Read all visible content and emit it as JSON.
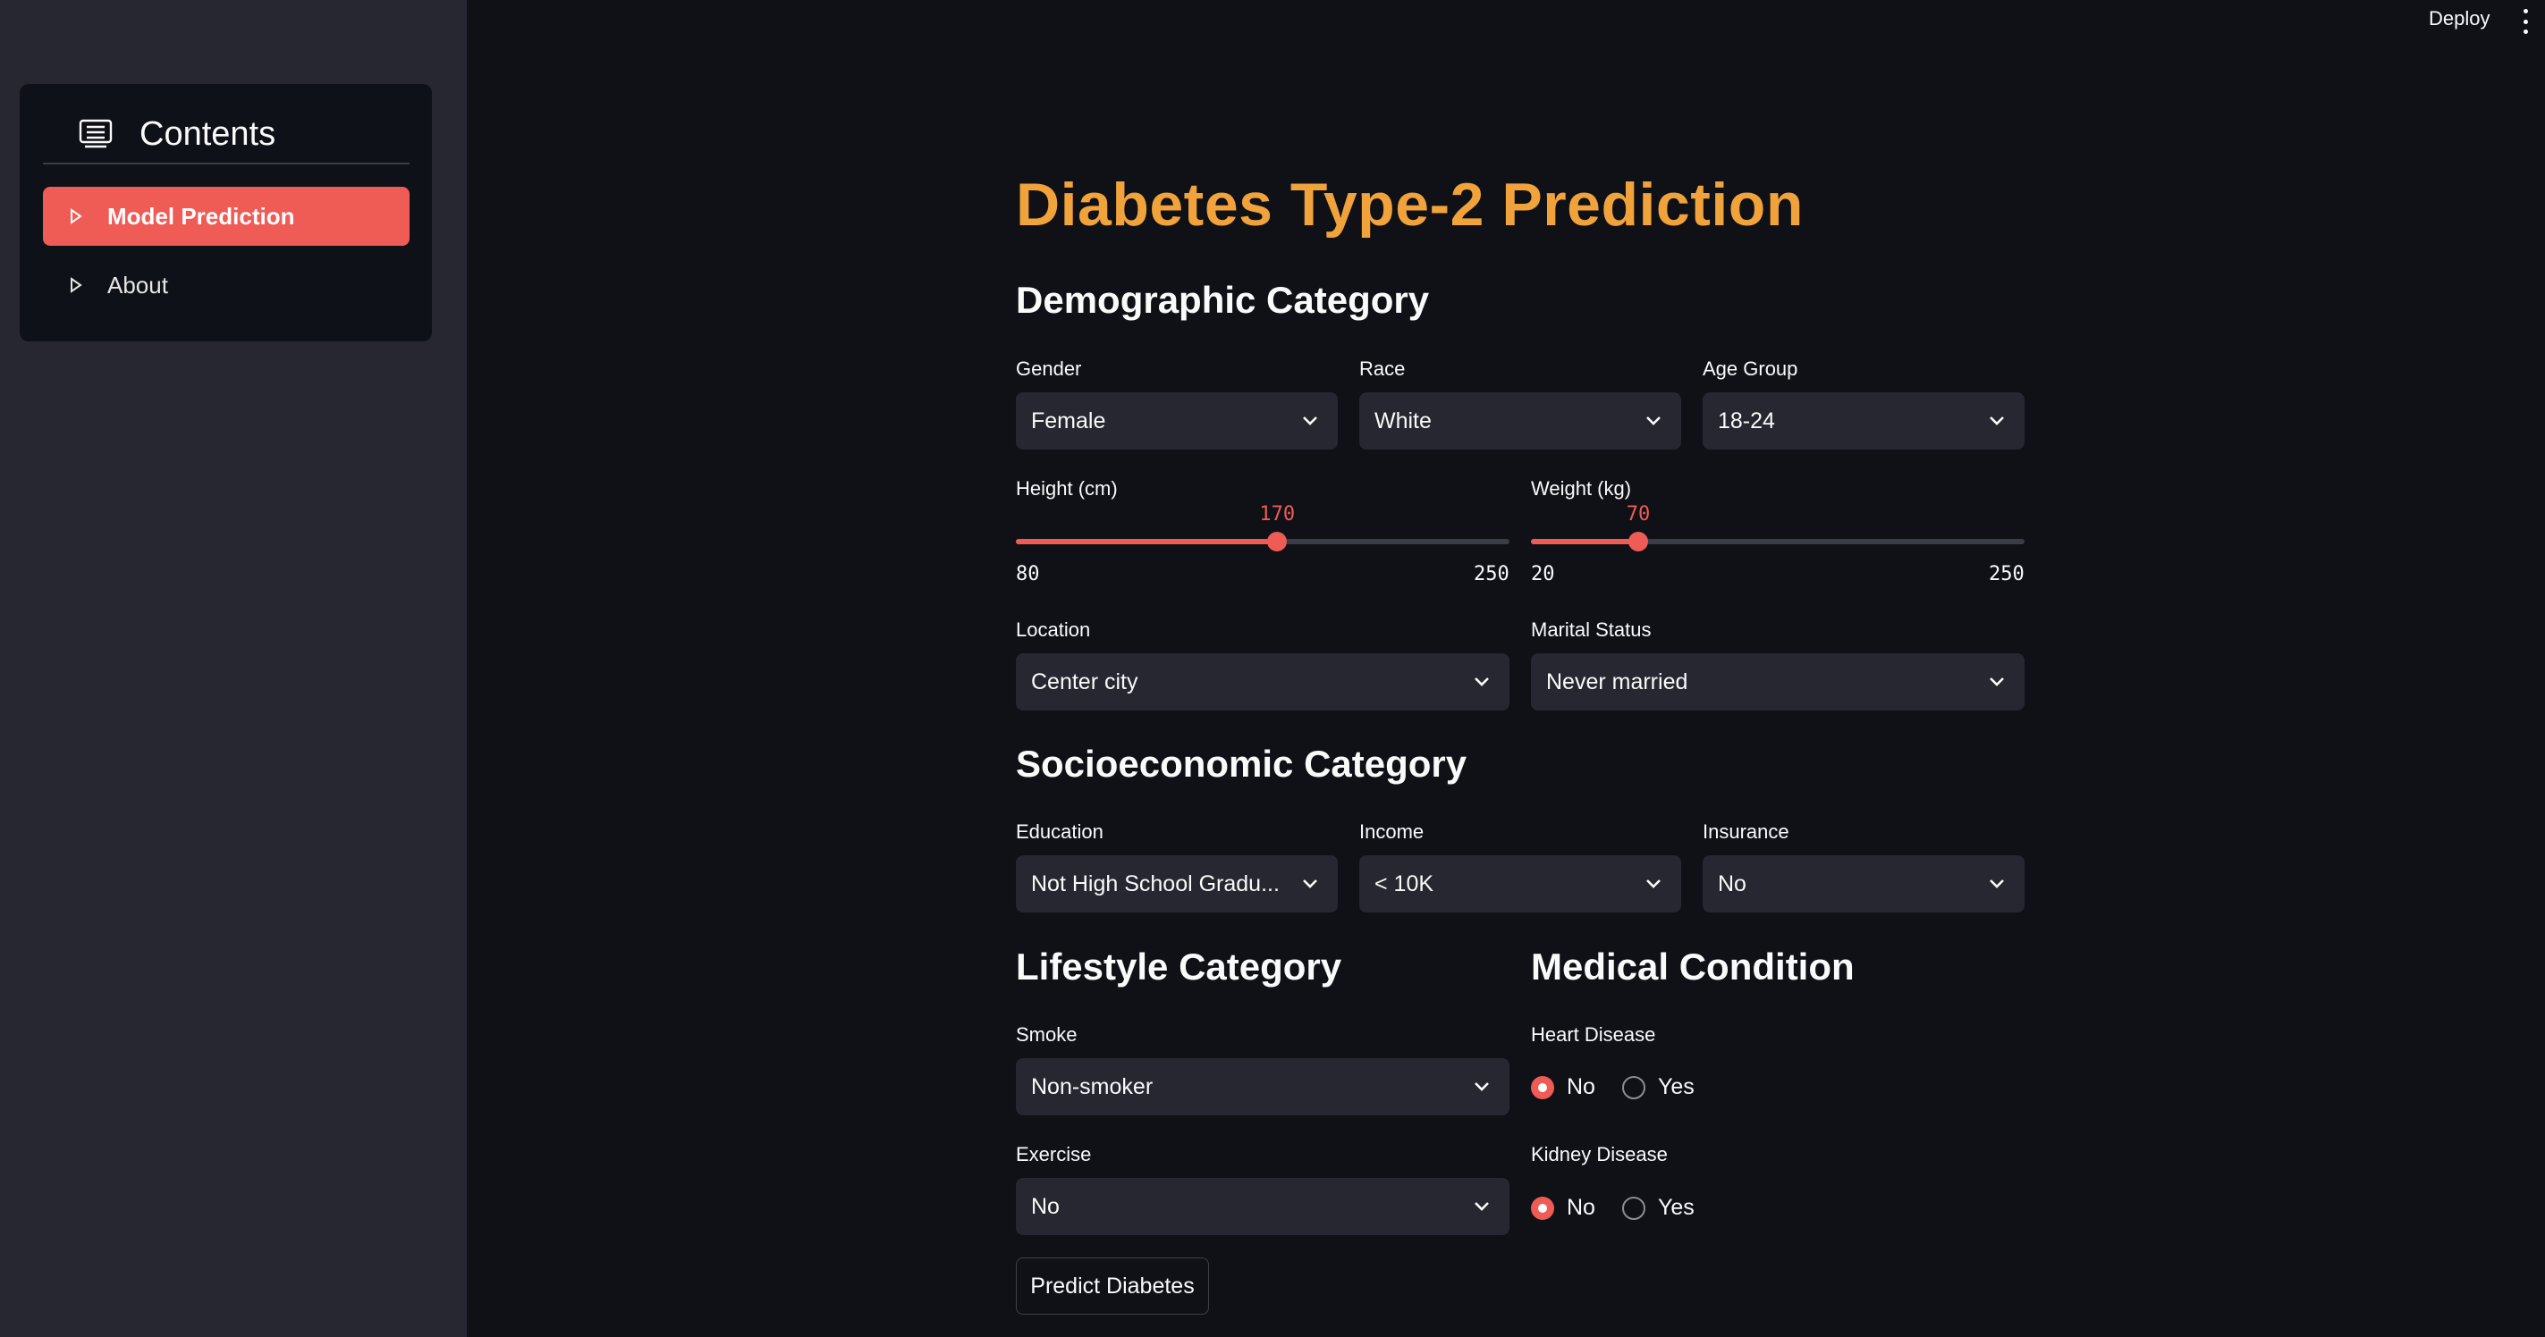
{
  "topbar": {
    "deploy_label": "Deploy"
  },
  "sidebar": {
    "title": "Contents",
    "items": [
      {
        "label": "Model Prediction",
        "active": true
      },
      {
        "label": "About",
        "active": false
      }
    ]
  },
  "main": {
    "title": "Diabetes Type-2 Prediction",
    "demographic": {
      "title": "Demographic Category",
      "gender": {
        "label": "Gender",
        "value": "Female"
      },
      "race": {
        "label": "Race",
        "value": "White"
      },
      "age_group": {
        "label": "Age Group",
        "value": "18-24"
      },
      "height": {
        "label": "Height (cm)",
        "value": 170,
        "min": 80,
        "max": 250
      },
      "weight": {
        "label": "Weight (kg)",
        "value": 70,
        "min": 20,
        "max": 250
      },
      "location": {
        "label": "Location",
        "value": "Center city"
      },
      "marital": {
        "label": "Marital Status",
        "value": "Never married"
      }
    },
    "socioeconomic": {
      "title": "Socioeconomic Category",
      "education": {
        "label": "Education",
        "value": "Not High School Gradu..."
      },
      "income": {
        "label": "Income",
        "value": "< 10K"
      },
      "insurance": {
        "label": "Insurance",
        "value": "No"
      }
    },
    "lifestyle": {
      "title": "Lifestyle Category",
      "smoke": {
        "label": "Smoke",
        "value": "Non-smoker"
      },
      "exercise": {
        "label": "Exercise",
        "value": "No"
      }
    },
    "medical": {
      "title": "Medical Condition",
      "heart": {
        "label": "Heart Disease",
        "options": [
          "No",
          "Yes"
        ],
        "selected": "No"
      },
      "kidney": {
        "label": "Kidney Disease",
        "options": [
          "No",
          "Yes"
        ],
        "selected": "No"
      }
    },
    "predict_button": "Predict Diabetes"
  },
  "colors": {
    "accent": "#ef5b55",
    "title": "#f0a23b",
    "background": "#0f1117",
    "sidebar": "#262730"
  }
}
